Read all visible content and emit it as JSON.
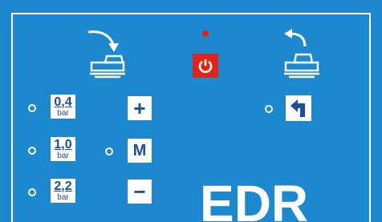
{
  "panel": {
    "background_color": "#1b88cf",
    "power_color": "#e2231a",
    "model_label": "EDR"
  },
  "pressure_options": [
    {
      "value": "0,4",
      "unit": "bar"
    },
    {
      "value": "1,0",
      "unit": "bar"
    },
    {
      "value": "2,2",
      "unit": "bar"
    }
  ],
  "keys": {
    "plus": "+",
    "mode": "M",
    "minus": "−"
  },
  "icons": {
    "power": "power-icon",
    "pedal_down": "pedal-arrow-down-icon",
    "pedal_return": "pedal-arrow-return-icon",
    "return": "return-arrow-icon"
  }
}
